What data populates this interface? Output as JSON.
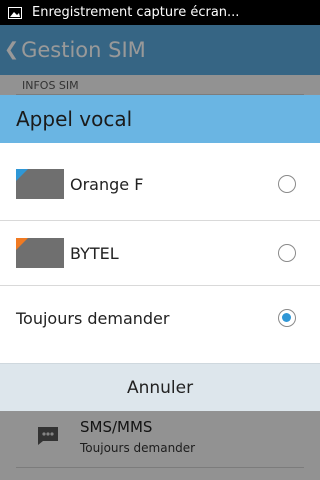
{
  "status_bar": {
    "notification_icon": "image-icon",
    "notification_text": "Enregistrement capture écran..."
  },
  "app": {
    "back_icon": "chevron-left-icon",
    "title": "Gestion SIM",
    "section_header": "INFOS SIM",
    "sms_row": {
      "icon": "message-icon",
      "title": "SMS/MMS",
      "subtitle": "Toujours demander"
    }
  },
  "dialog": {
    "title": "Appel vocal",
    "options": [
      {
        "label": "Orange F",
        "has_sim_thumb": true,
        "corner_color": "#2f97d6",
        "selected": false
      },
      {
        "label": "BYTEL",
        "has_sim_thumb": true,
        "corner_color": "#f07a22",
        "selected": false
      },
      {
        "label": "Toujours demander",
        "has_sim_thumb": false,
        "selected": true
      }
    ],
    "cancel_label": "Annuler"
  },
  "colors": {
    "header_blue": "#5aa9dd",
    "dialog_title_blue": "#6ab5e3",
    "radio_selected": "#2f97d6",
    "cancel_bg": "#dde6ec"
  }
}
